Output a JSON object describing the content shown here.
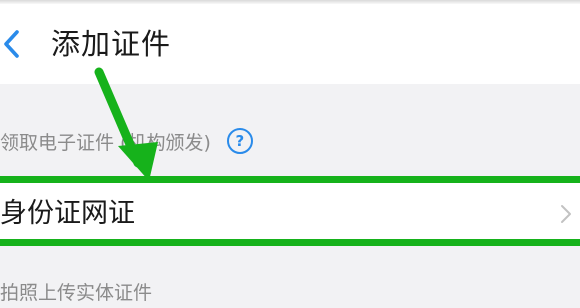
{
  "header": {
    "back_icon": "chevron-left-icon",
    "title": "添加证件"
  },
  "sections": {
    "electronic": {
      "label": "领取电子证件 (机构颁发)",
      "help_icon": "question-circle-icon",
      "help_glyph": "?"
    },
    "items": [
      {
        "label": "身份证网证",
        "chevron": "chevron-right-icon"
      }
    ],
    "photo": {
      "label": "拍照上传实体证件"
    }
  },
  "annotation": {
    "arrow_color": "#16b21b",
    "highlight_color": "#16b21b"
  },
  "colors": {
    "accent": "#2a8bea",
    "background": "#f2f2f4",
    "card": "#ffffff"
  }
}
